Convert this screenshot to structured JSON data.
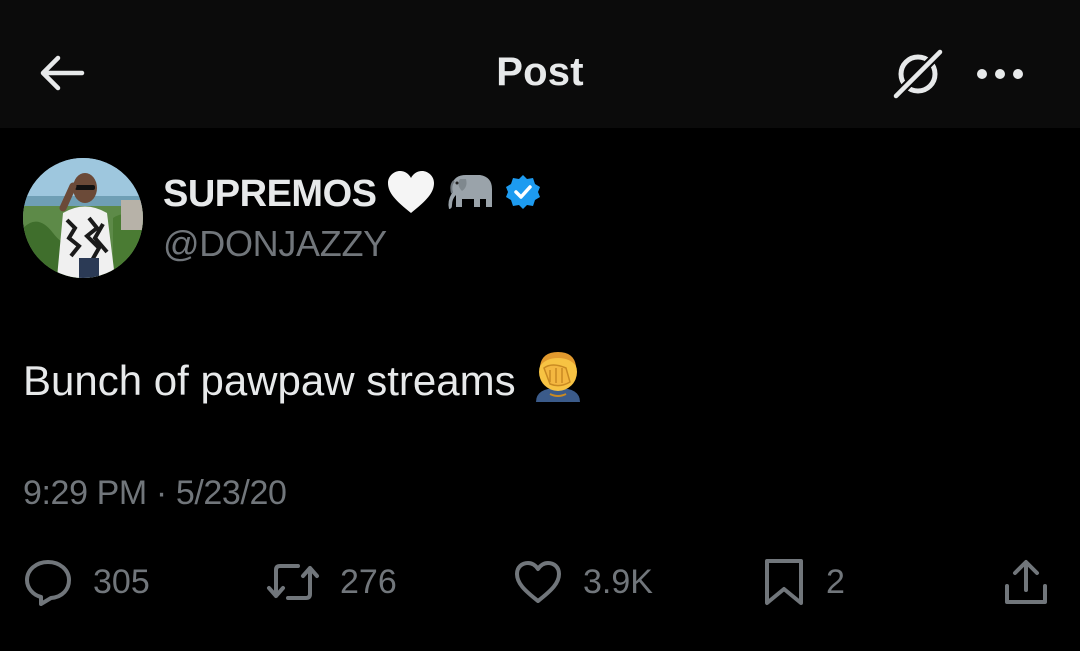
{
  "header": {
    "title": "Post",
    "back_icon": "arrow-left-icon",
    "grok_icon": "grok-icon",
    "more_icon": "more-horizontal-icon"
  },
  "author": {
    "display_name": "SUPREMOS",
    "emojis": [
      "🤍",
      "🐘"
    ],
    "handle": "@DONJAZZY",
    "verified_color": "#1d9bf0"
  },
  "post": {
    "text": "Bunch of pawpaw streams",
    "emoji": "🤦‍♂️",
    "timestamp": "9:29 PM · 5/23/20"
  },
  "stats": {
    "replies": "305",
    "reposts": "276",
    "likes": "3.9K",
    "bookmarks": "2"
  },
  "colors": {
    "background": "#000000",
    "header_bg": "#0b0b0b",
    "text": "#e7e9ea",
    "muted": "#71767b"
  }
}
